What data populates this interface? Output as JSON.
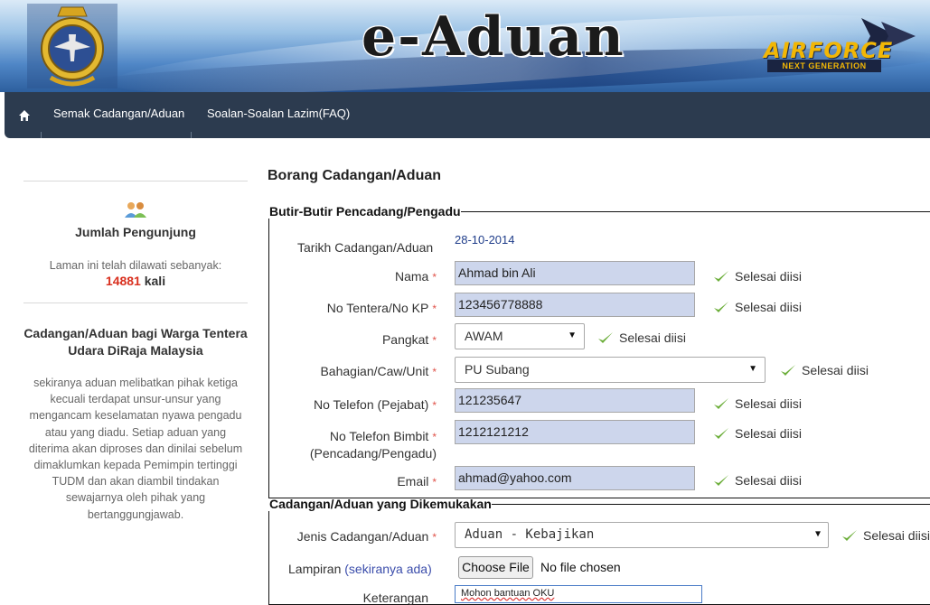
{
  "header": {
    "title": "e-Aduan",
    "logo_text": "AIRFORCE",
    "logo_tagline": "NEXT GENERATION"
  },
  "nav": {
    "items": [
      {
        "label": "Semak Cadangan/Aduan"
      },
      {
        "label": "Soalan-Soalan Lazim(FAQ)"
      }
    ]
  },
  "sidebar": {
    "visitor_title": "Jumlah Pengunjung",
    "visitor_text": "Laman ini telah dilawati sebanyak:",
    "visitor_count": "14881",
    "visitor_unit": "kali",
    "info_title": "Cadangan/Aduan bagi Warga Tentera Udara DiRaja Malaysia",
    "info_text": "sekiranya aduan melibatkan pihak ketiga kecuali terdapat unsur-unsur yang mengancam keselamatan nyawa pengadu atau yang diadu. Setiap aduan yang diterima akan diproses dan dinilai sebelum dimaklumkan kepada Pemimpin tertinggi TUDM dan akan diambil tindakan sewajarnya oleh pihak yang bertanggungjawab."
  },
  "form": {
    "title": "Borang Cadangan/Aduan",
    "section1_title": "Butir-Butir Pencadang/Pengadu",
    "section2_title": "Cadangan/Aduan yang Dikemukakan",
    "required_mark": "*",
    "done_text": "Selesai diisi",
    "date_label": "Tarikh Cadangan/Aduan",
    "date_value": "28-10-2014",
    "nama_label": "Nama",
    "nama_value": "Ahmad bin Ali",
    "kp_label": "No Tentera/No KP",
    "kp_value": "123456778888",
    "pangkat_label": "Pangkat",
    "pangkat_value": "AWAM",
    "bahagian_label": "Bahagian/Caw/Unit",
    "bahagian_value": "PU Subang",
    "tel_label": "No Telefon (Pejabat)",
    "tel_value": "121235647",
    "bimbit_label_1": "No Telefon Bimbit",
    "bimbit_label_2": "(Pencadang/Pengadu)",
    "bimbit_value": "1212121212",
    "email_label": "Email",
    "email_value": "ahmad@yahoo.com",
    "jenis_label": "Jenis Cadangan/Aduan",
    "jenis_value": "Aduan - Kebajikan",
    "lampiran_label": "Lampiran",
    "lampiran_note": "(sekiranya ada)",
    "file_button": "Choose File",
    "file_status": "No file chosen",
    "keterangan_label": "Keterangan",
    "keterangan_value": "Mohon bantuan OKU"
  },
  "colors": {
    "nav_bg": "#2c3b4f",
    "input_bg": "#cdd6ec",
    "required": "#e0534b",
    "check": "#6cae3a",
    "count": "#d9301f"
  }
}
